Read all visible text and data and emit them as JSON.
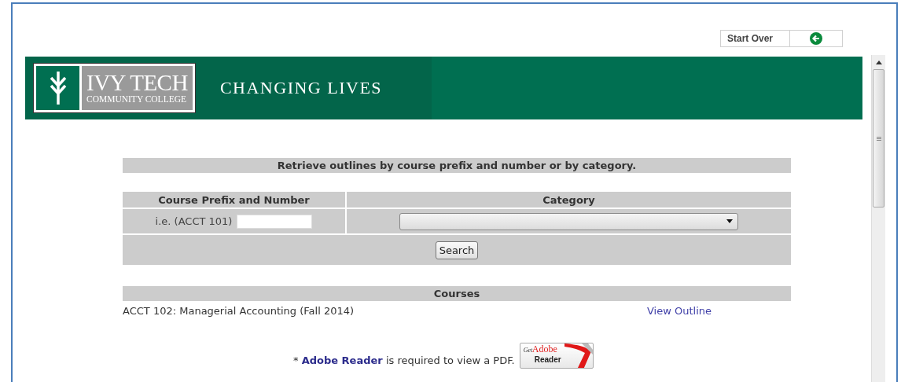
{
  "top_link": {
    "label": "Start Over"
  },
  "banner": {
    "logo_name": "IVY TECH",
    "logo_sub": "COMMUNITY COLLEGE",
    "tagline": "CHANGING LIVES"
  },
  "search_form": {
    "title": "Retrieve outlines by course prefix and number or by category.",
    "columns": [
      "Course Prefix and Number",
      "Category"
    ],
    "prefix_hint": "i.e. (ACCT 101)",
    "button": "Search"
  },
  "courses": {
    "title": "Courses",
    "rows": [
      {
        "name": "ACCT 102: Managerial Accounting (Fall 2014)",
        "link": "View Outline"
      }
    ]
  },
  "pdf_notice": {
    "prefix": "*",
    "link": "Adobe Reader",
    "suffix": "is required to view a PDF.",
    "badge": {
      "get": "Get",
      "brand": "Adobe",
      "product": "Reader"
    }
  }
}
